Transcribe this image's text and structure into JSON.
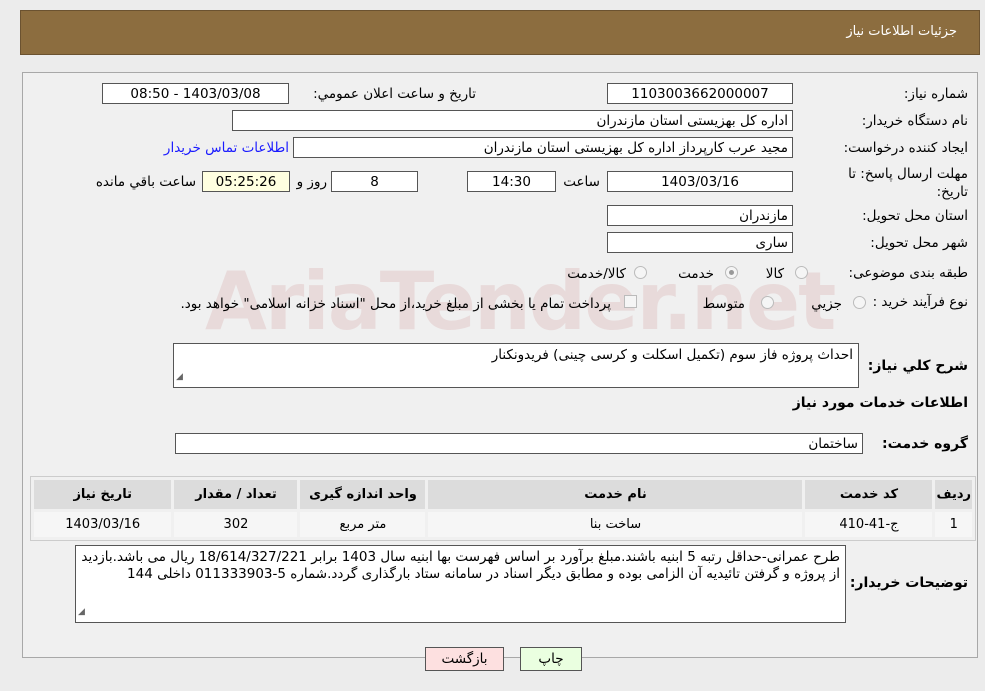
{
  "header": {
    "title": "جزئیات اطلاعات نیاز"
  },
  "watermark": "AriaTender.net",
  "form": {
    "need_number_label": "شماره نیاز:",
    "need_number": "1103003662000007",
    "announce_label": "تاریخ و ساعت اعلان عمومي:",
    "announce_value": "1403/03/08 - 08:50",
    "buyer_org_label": "نام دستگاه خریدار:",
    "buyer_org": "اداره کل بهزیستی استان مازندران",
    "creator_label": "ایجاد کننده درخواست:",
    "creator": "مجید عرب کارپرداز اداره کل بهزیستی استان مازندران",
    "contact_link": "اطلاعات تماس خریدار",
    "deadline_label": "مهلت ارسال پاسخ: تا تاریخ:",
    "deadline_date": "1403/03/16",
    "time_label": "ساعت",
    "deadline_time": "14:30",
    "days": "8",
    "days_label": "روز و",
    "remaining": "05:25:26",
    "remaining_label": "ساعت باقي مانده",
    "province_label": "استان محل تحویل:",
    "province": "مازندران",
    "city_label": "شهر محل تحویل:",
    "city": "ساری",
    "category_label": "طبقه بندی موضوعی:",
    "category_options": [
      "کالا",
      "خدمت",
      "کالا/خدمت"
    ],
    "category_selected": "خدمت",
    "process_label": "نوع فرآیند خرید :",
    "process_options": [
      "جزيي",
      "متوسط"
    ],
    "payment_note": "پرداخت تمام یا بخشی از مبلغ خرید،از محل \"اسناد خزانه اسلامی\" خواهد بود.",
    "description_label": "شرح کلي نیاز:",
    "description": "احداث پروژه فاز سوم (تکمیل اسکلت و کرسی چینی) فریدونکنار",
    "services_heading": "اطلاعات خدمات مورد نیاز",
    "service_group_label": "گروه خدمت:",
    "service_group": "ساختمان"
  },
  "table": {
    "headers": [
      "ردیف",
      "کد خدمت",
      "نام خدمت",
      "واحد اندازه گیری",
      "تعداد / مقدار",
      "تاریخ نیاز"
    ],
    "rows": [
      [
        "1",
        "ج-41-410",
        "ساخت بنا",
        "متر مربع",
        "302",
        "1403/03/16"
      ]
    ]
  },
  "notes": {
    "label": "توضیحات خریدار:",
    "text": "طرح عمرانی-حداقل رتبه 5 ابنیه باشند.مبلغ برآورد بر اساس فهرست بها ابنیه سال 1403 برابر 18/614/327/221 ریال می باشد.بازدید از پروژه و گرفتن تائیدیه آن الزامی بوده و مطابق دیگر اسناد در سامانه ستاد بارگذاری گردد.شماره 5-011333903 داخلی 144"
  },
  "buttons": {
    "back": "بازگشت",
    "print": "چاپ"
  },
  "colors": {
    "header": "#8c6d3f",
    "back_btn": "#fde0e0",
    "print_btn": "#eaffe0",
    "link": "#1a1aff"
  }
}
